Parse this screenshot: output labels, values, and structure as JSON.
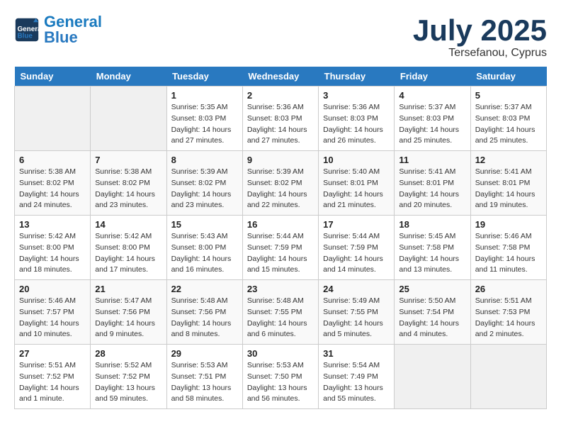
{
  "header": {
    "logo_general": "General",
    "logo_blue": "Blue",
    "month_title": "July 2025",
    "subtitle": "Tersefanou, Cyprus"
  },
  "days_of_week": [
    "Sunday",
    "Monday",
    "Tuesday",
    "Wednesday",
    "Thursday",
    "Friday",
    "Saturday"
  ],
  "weeks": [
    [
      {
        "day": "",
        "sunrise": "",
        "sunset": "",
        "daylight": ""
      },
      {
        "day": "",
        "sunrise": "",
        "sunset": "",
        "daylight": ""
      },
      {
        "day": "1",
        "sunrise": "Sunrise: 5:35 AM",
        "sunset": "Sunset: 8:03 PM",
        "daylight": "Daylight: 14 hours and 27 minutes."
      },
      {
        "day": "2",
        "sunrise": "Sunrise: 5:36 AM",
        "sunset": "Sunset: 8:03 PM",
        "daylight": "Daylight: 14 hours and 27 minutes."
      },
      {
        "day": "3",
        "sunrise": "Sunrise: 5:36 AM",
        "sunset": "Sunset: 8:03 PM",
        "daylight": "Daylight: 14 hours and 26 minutes."
      },
      {
        "day": "4",
        "sunrise": "Sunrise: 5:37 AM",
        "sunset": "Sunset: 8:03 PM",
        "daylight": "Daylight: 14 hours and 25 minutes."
      },
      {
        "day": "5",
        "sunrise": "Sunrise: 5:37 AM",
        "sunset": "Sunset: 8:03 PM",
        "daylight": "Daylight: 14 hours and 25 minutes."
      }
    ],
    [
      {
        "day": "6",
        "sunrise": "Sunrise: 5:38 AM",
        "sunset": "Sunset: 8:02 PM",
        "daylight": "Daylight: 14 hours and 24 minutes."
      },
      {
        "day": "7",
        "sunrise": "Sunrise: 5:38 AM",
        "sunset": "Sunset: 8:02 PM",
        "daylight": "Daylight: 14 hours and 23 minutes."
      },
      {
        "day": "8",
        "sunrise": "Sunrise: 5:39 AM",
        "sunset": "Sunset: 8:02 PM",
        "daylight": "Daylight: 14 hours and 23 minutes."
      },
      {
        "day": "9",
        "sunrise": "Sunrise: 5:39 AM",
        "sunset": "Sunset: 8:02 PM",
        "daylight": "Daylight: 14 hours and 22 minutes."
      },
      {
        "day": "10",
        "sunrise": "Sunrise: 5:40 AM",
        "sunset": "Sunset: 8:01 PM",
        "daylight": "Daylight: 14 hours and 21 minutes."
      },
      {
        "day": "11",
        "sunrise": "Sunrise: 5:41 AM",
        "sunset": "Sunset: 8:01 PM",
        "daylight": "Daylight: 14 hours and 20 minutes."
      },
      {
        "day": "12",
        "sunrise": "Sunrise: 5:41 AM",
        "sunset": "Sunset: 8:01 PM",
        "daylight": "Daylight: 14 hours and 19 minutes."
      }
    ],
    [
      {
        "day": "13",
        "sunrise": "Sunrise: 5:42 AM",
        "sunset": "Sunset: 8:00 PM",
        "daylight": "Daylight: 14 hours and 18 minutes."
      },
      {
        "day": "14",
        "sunrise": "Sunrise: 5:42 AM",
        "sunset": "Sunset: 8:00 PM",
        "daylight": "Daylight: 14 hours and 17 minutes."
      },
      {
        "day": "15",
        "sunrise": "Sunrise: 5:43 AM",
        "sunset": "Sunset: 8:00 PM",
        "daylight": "Daylight: 14 hours and 16 minutes."
      },
      {
        "day": "16",
        "sunrise": "Sunrise: 5:44 AM",
        "sunset": "Sunset: 7:59 PM",
        "daylight": "Daylight: 14 hours and 15 minutes."
      },
      {
        "day": "17",
        "sunrise": "Sunrise: 5:44 AM",
        "sunset": "Sunset: 7:59 PM",
        "daylight": "Daylight: 14 hours and 14 minutes."
      },
      {
        "day": "18",
        "sunrise": "Sunrise: 5:45 AM",
        "sunset": "Sunset: 7:58 PM",
        "daylight": "Daylight: 14 hours and 13 minutes."
      },
      {
        "day": "19",
        "sunrise": "Sunrise: 5:46 AM",
        "sunset": "Sunset: 7:58 PM",
        "daylight": "Daylight: 14 hours and 11 minutes."
      }
    ],
    [
      {
        "day": "20",
        "sunrise": "Sunrise: 5:46 AM",
        "sunset": "Sunset: 7:57 PM",
        "daylight": "Daylight: 14 hours and 10 minutes."
      },
      {
        "day": "21",
        "sunrise": "Sunrise: 5:47 AM",
        "sunset": "Sunset: 7:56 PM",
        "daylight": "Daylight: 14 hours and 9 minutes."
      },
      {
        "day": "22",
        "sunrise": "Sunrise: 5:48 AM",
        "sunset": "Sunset: 7:56 PM",
        "daylight": "Daylight: 14 hours and 8 minutes."
      },
      {
        "day": "23",
        "sunrise": "Sunrise: 5:48 AM",
        "sunset": "Sunset: 7:55 PM",
        "daylight": "Daylight: 14 hours and 6 minutes."
      },
      {
        "day": "24",
        "sunrise": "Sunrise: 5:49 AM",
        "sunset": "Sunset: 7:55 PM",
        "daylight": "Daylight: 14 hours and 5 minutes."
      },
      {
        "day": "25",
        "sunrise": "Sunrise: 5:50 AM",
        "sunset": "Sunset: 7:54 PM",
        "daylight": "Daylight: 14 hours and 4 minutes."
      },
      {
        "day": "26",
        "sunrise": "Sunrise: 5:51 AM",
        "sunset": "Sunset: 7:53 PM",
        "daylight": "Daylight: 14 hours and 2 minutes."
      }
    ],
    [
      {
        "day": "27",
        "sunrise": "Sunrise: 5:51 AM",
        "sunset": "Sunset: 7:52 PM",
        "daylight": "Daylight: 14 hours and 1 minute."
      },
      {
        "day": "28",
        "sunrise": "Sunrise: 5:52 AM",
        "sunset": "Sunset: 7:52 PM",
        "daylight": "Daylight: 13 hours and 59 minutes."
      },
      {
        "day": "29",
        "sunrise": "Sunrise: 5:53 AM",
        "sunset": "Sunset: 7:51 PM",
        "daylight": "Daylight: 13 hours and 58 minutes."
      },
      {
        "day": "30",
        "sunrise": "Sunrise: 5:53 AM",
        "sunset": "Sunset: 7:50 PM",
        "daylight": "Daylight: 13 hours and 56 minutes."
      },
      {
        "day": "31",
        "sunrise": "Sunrise: 5:54 AM",
        "sunset": "Sunset: 7:49 PM",
        "daylight": "Daylight: 13 hours and 55 minutes."
      },
      {
        "day": "",
        "sunrise": "",
        "sunset": "",
        "daylight": ""
      },
      {
        "day": "",
        "sunrise": "",
        "sunset": "",
        "daylight": ""
      }
    ]
  ]
}
